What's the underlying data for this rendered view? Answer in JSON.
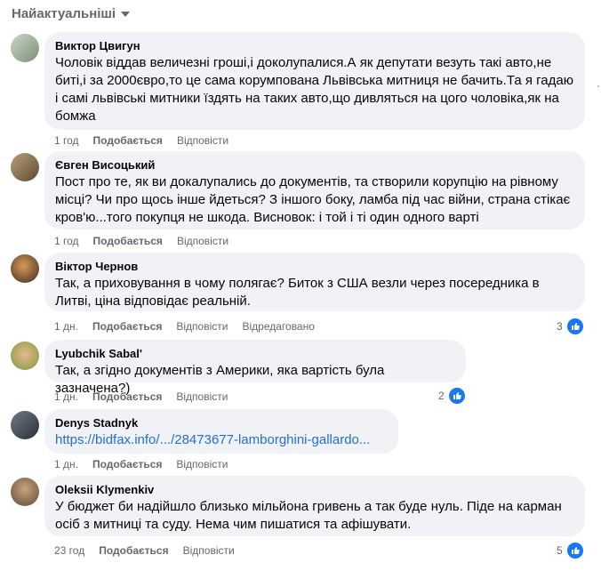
{
  "sort": {
    "label": "Найактуальніші"
  },
  "actions": {
    "like": "Подобається",
    "reply": "Відповісти"
  },
  "comments": [
    {
      "author": "Виктор Цвигун",
      "text": "Чоловік віддав величезні гроші,і доколупалися.А як депутати везуть такі авто,не биті,і за 2000євро,то це сама корумпована Львівська митниця не бачить.Та я гадаю і самі львівські митники їздять на таких авто,що дивляться на цого чоловіка,як на бомжа",
      "time": "1 год",
      "edited": "",
      "reactions": ""
    },
    {
      "author": "Євген Висоцький",
      "text": "Пост про те, як ви докалупались до документів, та створили корупцію на рівному місці? Чи про щось інше йдеться? З іншого боку, ламба під час війни, страна стікає кров'ю...того покупця не шкода. Висновок: і той і ті один одного варті",
      "time": "1 год",
      "edited": "",
      "reactions": ""
    },
    {
      "author": "Віктор Чернов",
      "text": "Так, а приховування в чому полягає? Биток з США везли через посередника в Литві, ціна відповідає реальній.",
      "time": "1 дн.",
      "edited": "Відредаговано",
      "reactions": "3"
    },
    {
      "author": "Lyubchik Sabal'",
      "text": "Так, а згідно документів з Америки, яка вартість була зазначена?)",
      "time": "1 дн.",
      "edited": "",
      "reactions": "2"
    },
    {
      "author": "Denys Stadnyk",
      "text": "https://bidfax.info/.../28473677-lamborghini-gallardo...",
      "time": "1 дн.",
      "edited": "",
      "reactions": ""
    },
    {
      "author": "Oleksii Klymenkiv",
      "text": "У бюджет би надійшло близько мільйона гривень а так буде нуль. Піде на карман осіб з митниці та суду. Нема чим пишатися та афішувати.",
      "time": "23 год",
      "edited": "",
      "reactions": "5"
    }
  ],
  "colors": {
    "bubble": "#f0f2f5",
    "meta": "#65676b",
    "link": "#216fdb",
    "like_badge": "#1877f2"
  }
}
